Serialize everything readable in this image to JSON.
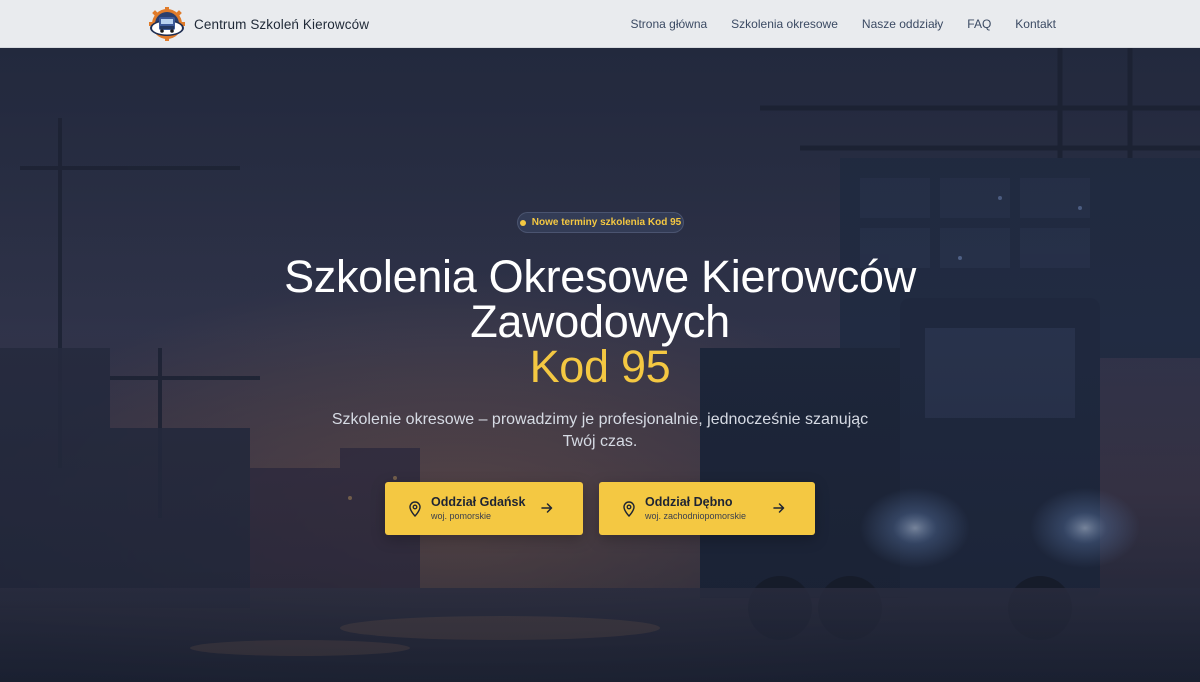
{
  "brand": {
    "name": "Centrum Szkoleń Kierowców"
  },
  "nav": {
    "links": [
      {
        "label": "Strona główna"
      },
      {
        "label": "Szkolenia okresowe"
      },
      {
        "label": "Nasze oddziały"
      },
      {
        "label": "FAQ"
      },
      {
        "label": "Kontakt"
      }
    ]
  },
  "hero": {
    "badge": "Nowe terminy szkolenia Kod 95",
    "title_line1": "Szkolenia Okresowe Kierowców",
    "title_line2": "Zawodowych",
    "title_accent": "Kod 95",
    "subtitle": "Szkolenie okresowe – prowadzimy je profesjonalnie, jednocześnie szanując Twój czas.",
    "buttons": [
      {
        "label": "Oddział Gdańsk",
        "region": "woj. pomorskie",
        "icon": "map-pin-icon"
      },
      {
        "label": "Oddział Dębno",
        "region": "woj. zachodniopomorskie",
        "icon": "map-pin-icon"
      }
    ]
  },
  "colors": {
    "accent": "#f4c842",
    "navbar_bg": "#e9ebee",
    "hero_overlay": "#1f2839",
    "text_dark": "#1e2433"
  }
}
